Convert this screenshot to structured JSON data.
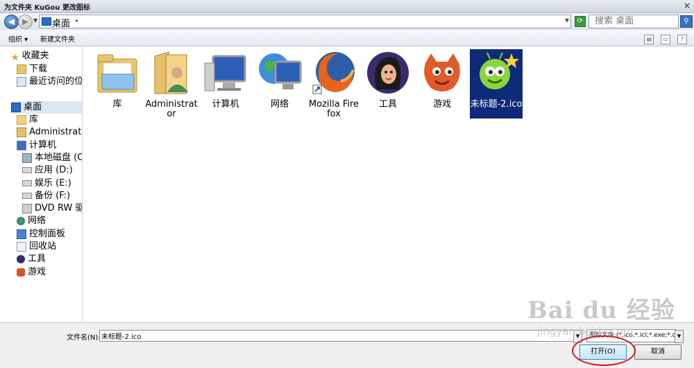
{
  "window": {
    "title": "为文件夹 KuGou 更改图标",
    "close_glyph": "×"
  },
  "address": {
    "location": "桌面",
    "search_placeholder": "搜索 桌面"
  },
  "toolbar": {
    "organize": "组织 ▾",
    "new_folder": "新建文件夹"
  },
  "sidebar": {
    "items": [
      {
        "label": "收藏夹",
        "icon": "star-icon"
      },
      {
        "label": "下载",
        "icon": "download-folder-icon"
      },
      {
        "label": "最近访问的位置",
        "icon": "recent-places-icon"
      },
      {
        "label": "桌面",
        "icon": "desktop-icon"
      },
      {
        "label": "库",
        "icon": "library-icon"
      },
      {
        "label": "Administrator",
        "icon": "user-folder-icon"
      },
      {
        "label": "计算机",
        "icon": "computer-icon"
      },
      {
        "label": "本地磁盘 (C:)",
        "icon": "local-disk-icon"
      },
      {
        "label": "应用 (D:)",
        "icon": "drive-icon"
      },
      {
        "label": "娱乐 (E:)",
        "icon": "drive-icon"
      },
      {
        "label": "备份 (F:)",
        "icon": "drive-icon"
      },
      {
        "label": "DVD RW 驱动器",
        "icon": "dvd-drive-icon"
      },
      {
        "label": "网络",
        "icon": "network-icon"
      },
      {
        "label": "控制面板",
        "icon": "control-panel-icon"
      },
      {
        "label": "回收站",
        "icon": "recycle-bin-icon"
      },
      {
        "label": "工具",
        "icon": "tools-icon"
      },
      {
        "label": "游戏",
        "icon": "games-icon"
      }
    ]
  },
  "files": [
    {
      "label": "库",
      "icon": "library-folder-icon"
    },
    {
      "label": "Administrator",
      "icon": "user-folder-icon"
    },
    {
      "label": "计算机",
      "icon": "computer-icon"
    },
    {
      "label": "网络",
      "icon": "network-icon"
    },
    {
      "label": "Mozilla Firefox",
      "icon": "firefox-icon"
    },
    {
      "label": "工具",
      "icon": "tools-icon"
    },
    {
      "label": "游戏",
      "icon": "games-icon"
    },
    {
      "label": "未标题-2.ico",
      "icon": "ico-file-icon"
    }
  ],
  "footer": {
    "filename_label": "文件名(N):",
    "filename_value": "未标题-2.ico",
    "filter": "图标文件 (*.ico;*.icl;*.exe;*.dll)",
    "open_label": "打开(O)",
    "cancel_label": "取消"
  },
  "watermark": {
    "brand": "Bai du 经验",
    "url": "jingyan.baidu.com"
  }
}
